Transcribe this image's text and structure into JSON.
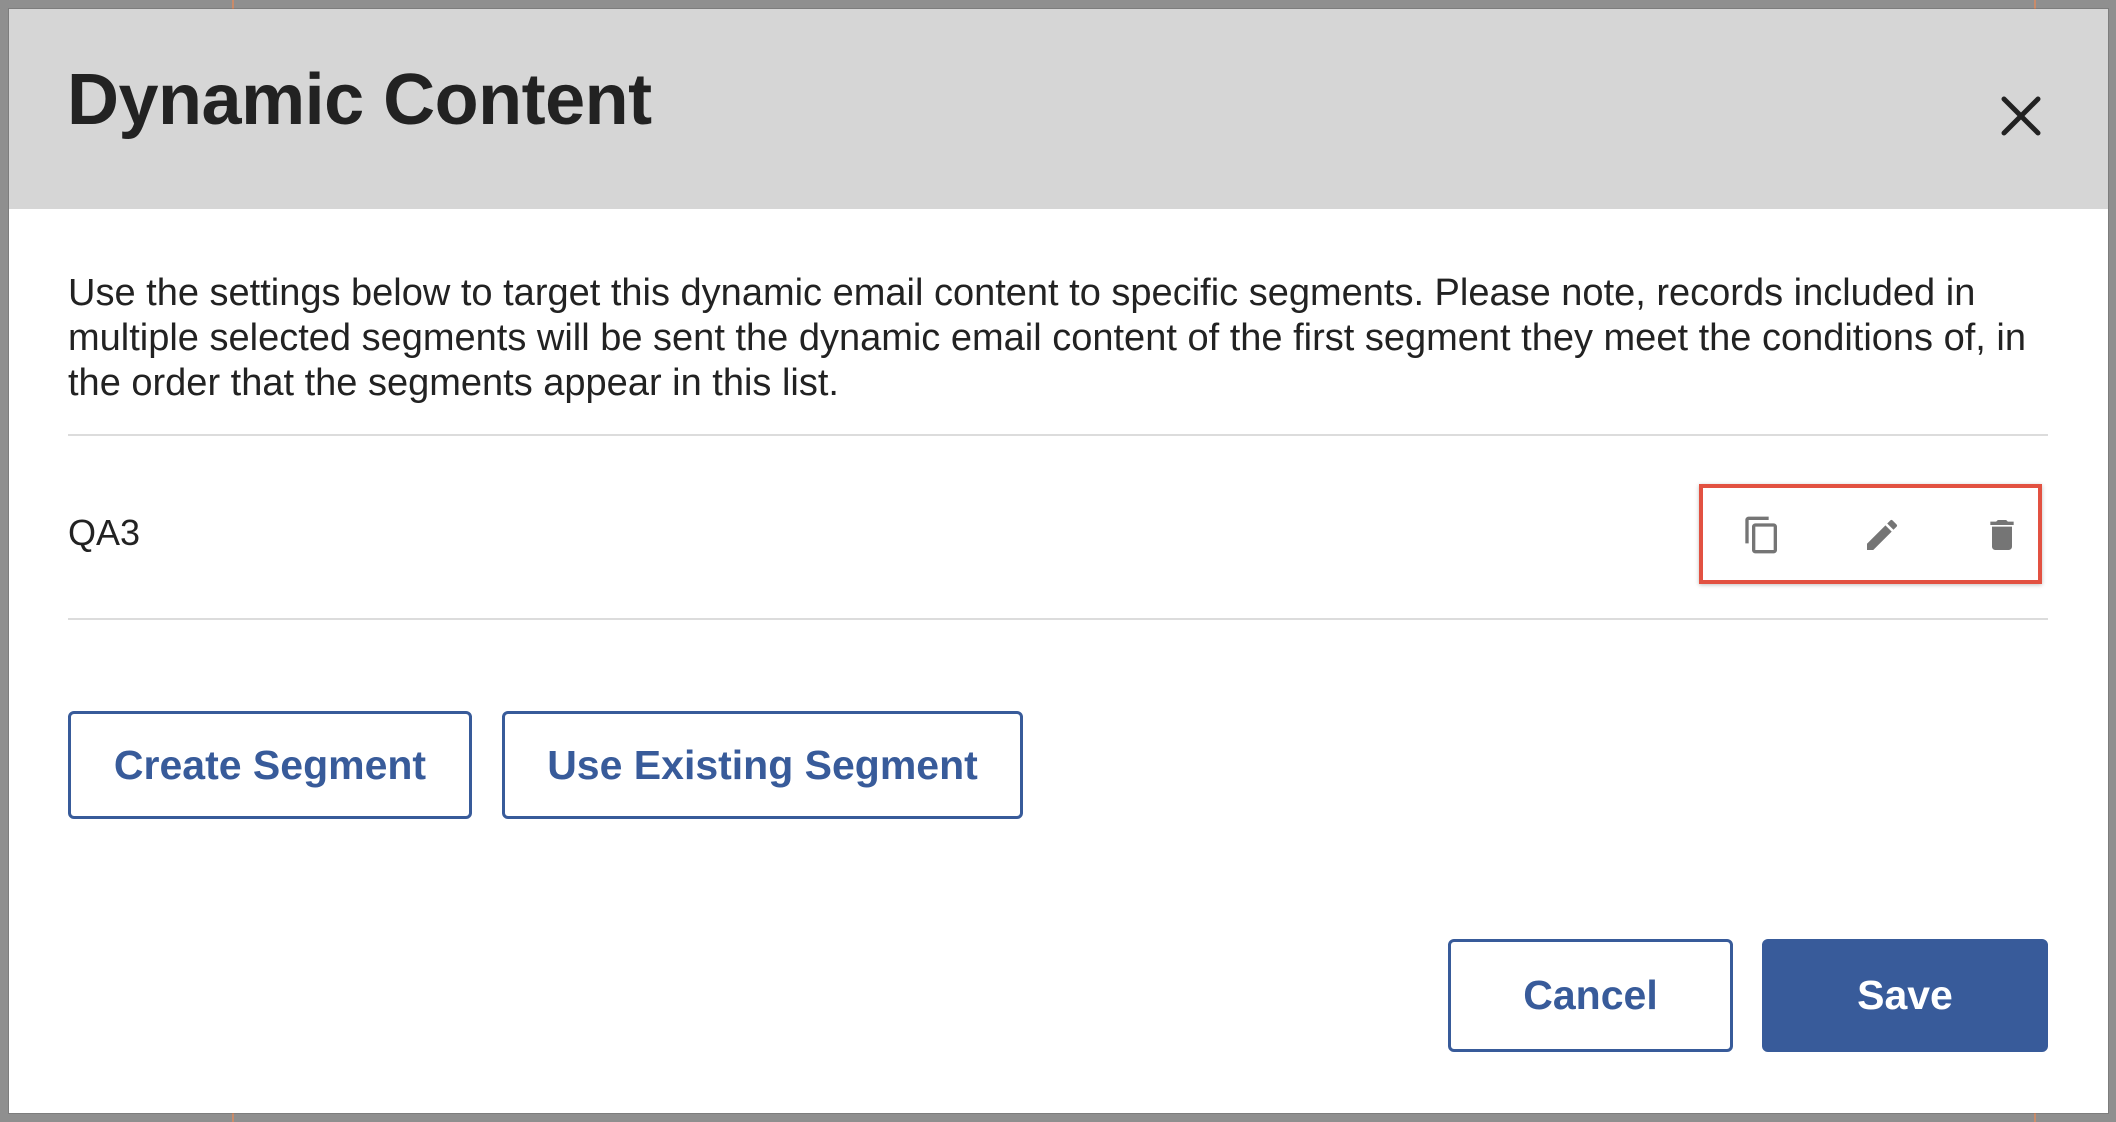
{
  "modal": {
    "title": "Dynamic Content",
    "close_icon": "close-icon",
    "intro_text": "Use the settings below to target this dynamic email content to specific segments. Please note, records included in multiple selected segments will be sent the dynamic email content of the first segment they meet the conditions of, in the order that the segments appear in this list."
  },
  "segments": [
    {
      "name": "QA3",
      "actions": [
        {
          "icon": "copy-icon"
        },
        {
          "icon": "edit-icon"
        },
        {
          "icon": "trash-icon"
        }
      ]
    }
  ],
  "segment_buttons": {
    "create": "Create Segment",
    "use_existing": "Use Existing Segment"
  },
  "footer": {
    "cancel": "Cancel",
    "save": "Save"
  },
  "colors": {
    "header_bg": "#d6d6d6",
    "accent": "#385b9a",
    "highlight": "#e25141",
    "icon": "#757575"
  }
}
